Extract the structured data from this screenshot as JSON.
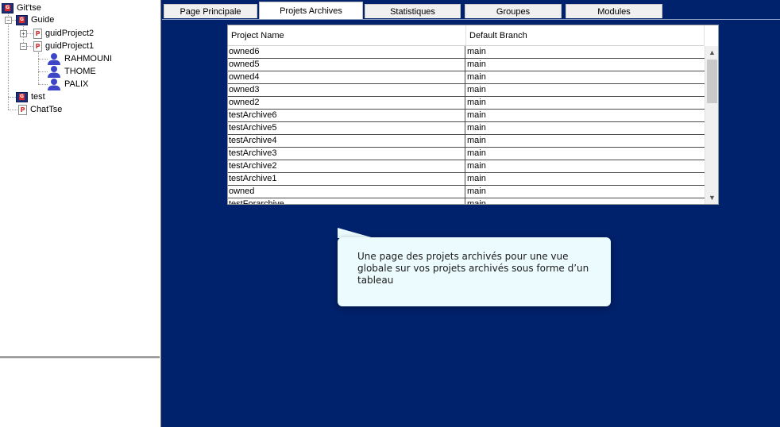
{
  "tree": {
    "root": {
      "label": "Git'tse",
      "icon": "group-icon"
    },
    "items": [
      {
        "label": "Guide",
        "icon": "group-icon",
        "expander": "−"
      },
      {
        "label": "guidProject2",
        "icon": "project-icon",
        "expander": "+"
      },
      {
        "label": "guidProject1",
        "icon": "project-icon",
        "expander": "−"
      },
      {
        "label": "RAHMOUNI",
        "icon": "user-icon"
      },
      {
        "label": "THOME",
        "icon": "user-icon"
      },
      {
        "label": "PALIX",
        "icon": "user-icon"
      },
      {
        "label": "test",
        "icon": "group-icon"
      },
      {
        "label": "ChatTse",
        "icon": "project-icon"
      }
    ]
  },
  "tabs": [
    {
      "label": "Page Principale",
      "active": false
    },
    {
      "label": "Projets Archives",
      "active": true
    },
    {
      "label": "Statistiques",
      "active": false
    },
    {
      "label": "Groupes",
      "active": false
    },
    {
      "label": "Modules",
      "active": false
    }
  ],
  "table": {
    "columns": [
      "Project Name",
      "Default Branch"
    ],
    "rows": [
      [
        "owned6",
        "main"
      ],
      [
        "owned5",
        "main"
      ],
      [
        "owned4",
        "main"
      ],
      [
        "owned3",
        "main"
      ],
      [
        "owned2",
        "main"
      ],
      [
        "testArchive6",
        "main"
      ],
      [
        "testArchive5",
        "main"
      ],
      [
        "testArchive4",
        "main"
      ],
      [
        "testArchive3",
        "main"
      ],
      [
        "testArchive2",
        "main"
      ],
      [
        "testArchive1",
        "main"
      ],
      [
        "owned",
        "main"
      ],
      [
        "testForarchive",
        "main"
      ]
    ]
  },
  "tooltip": {
    "text": "Une page des projets archivés pour une vue globale sur vos projets archivés sous forme d’un tableau"
  },
  "colors": {
    "background": "#00216b",
    "tooltip_bg": "#ecfcfe",
    "group_icon": "#1f2f7a",
    "project_icon_mark": "#d92b2b",
    "user_icon": "#3e46c8"
  },
  "icons": {
    "scroll_up": "▲",
    "scroll_down": "▼"
  }
}
